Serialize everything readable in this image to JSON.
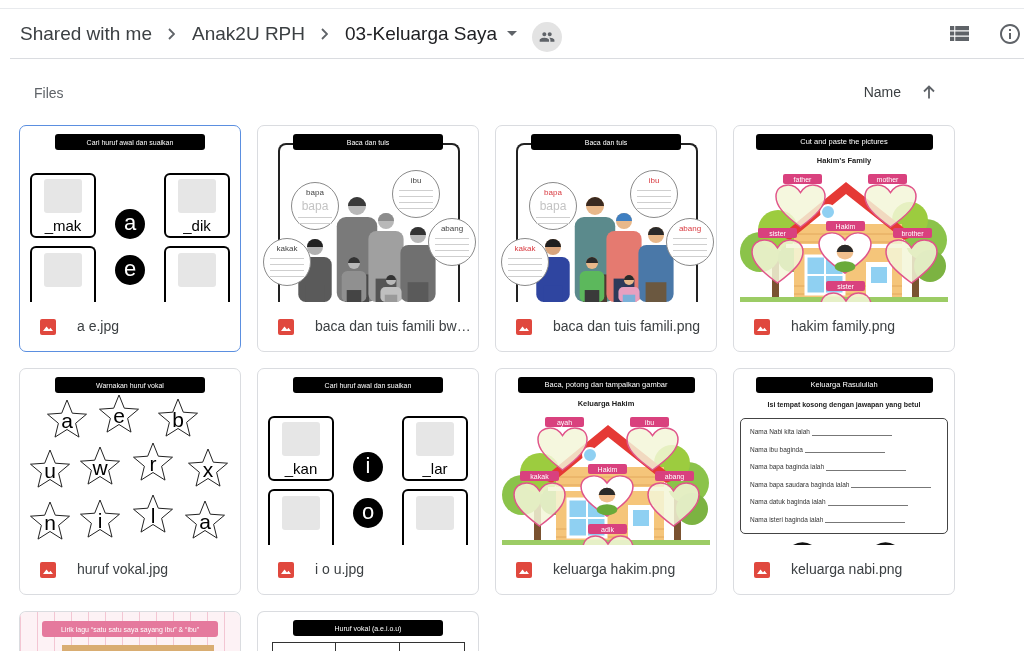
{
  "breadcrumb": [
    {
      "label": "Shared with me",
      "current": false
    },
    {
      "label": "Anak2U RPH",
      "current": false
    },
    {
      "label": "03-Keluarga Saya",
      "current": true
    }
  ],
  "section": {
    "label": "Files"
  },
  "sort": {
    "label": "Name",
    "ascending": true
  },
  "files": [
    {
      "name": "a e.jpg",
      "selected": true,
      "preview": {
        "kind": "match",
        "title": "Cari huruf awal dan suaikan",
        "cards": [
          "_mak",
          "_dik"
        ],
        "letters": [
          "a",
          "e"
        ]
      }
    },
    {
      "name": "baca dan tuis famili bw…",
      "selected": false,
      "preview": {
        "kind": "speech",
        "title": "Baca dan tuis",
        "grayscale": true,
        "bubbles": [
          {
            "word": "bapa",
            "trace": "bapa"
          },
          {
            "word": "ibu"
          },
          {
            "word": "abang"
          },
          {
            "word": "kakak"
          }
        ]
      }
    },
    {
      "name": "baca dan tuis famili.png",
      "selected": false,
      "preview": {
        "kind": "speech",
        "title": "Baca dan tuis",
        "grayscale": false,
        "bubbles": [
          {
            "word": "bapa",
            "trace": "bapa"
          },
          {
            "word": "ibu"
          },
          {
            "word": "abang"
          },
          {
            "word": "kakak"
          }
        ]
      }
    },
    {
      "name": "hakim family.png",
      "selected": false,
      "preview": {
        "kind": "house",
        "title": "Cut and paste the pictures",
        "subtitle": "Hakim’s Family",
        "tags": [
          "father",
          "mother",
          "Hakim",
          "sister",
          "brother",
          "sister"
        ]
      }
    },
    {
      "name": "huruf vokal.jpg",
      "selected": false,
      "preview": {
        "kind": "stars",
        "title": "Warnakan huruf vokal",
        "letters": [
          "a",
          "e",
          "b",
          "u",
          "w",
          "r",
          "x",
          "n",
          "i",
          "l",
          "a"
        ]
      }
    },
    {
      "name": "i o u.jpg",
      "selected": false,
      "preview": {
        "kind": "match",
        "title": "Cari huruf awal dan suaikan",
        "cards": [
          "_kan",
          "_lar"
        ],
        "letters": [
          "i",
          "o"
        ]
      }
    },
    {
      "name": "keluarga hakim.png",
      "selected": false,
      "preview": {
        "kind": "house",
        "title": "Baca, potong dan tampalkan gambar",
        "subtitle": "Keluarga Hakim",
        "tags": [
          "ayah",
          "ibu",
          "Hakim",
          "kakak",
          "abang",
          "adik"
        ]
      }
    },
    {
      "name": "keluarga nabi.png",
      "selected": false,
      "preview": {
        "kind": "form",
        "title": "Keluarga Rasulullah",
        "subtitle": "Isi tempat kosong dengan jawapan yang betul",
        "lines": [
          "Nama Nabi kita ialah",
          "Nama ibu baginda",
          "Nama bapa baginda ialah",
          "Nama bapa saudara baginda ialah",
          "Nama datuk baginda ialah",
          "Nama isteri baginda ialah"
        ]
      }
    },
    {
      "selected": false,
      "preview": {
        "kind": "lyrics",
        "title": "Lirik lagu “satu satu saya sayang ibu” & “ibu”"
      }
    },
    {
      "selected": false,
      "preview": {
        "kind": "table",
        "title": "Huruf vokal (a.e.i.o.u)"
      }
    }
  ]
}
